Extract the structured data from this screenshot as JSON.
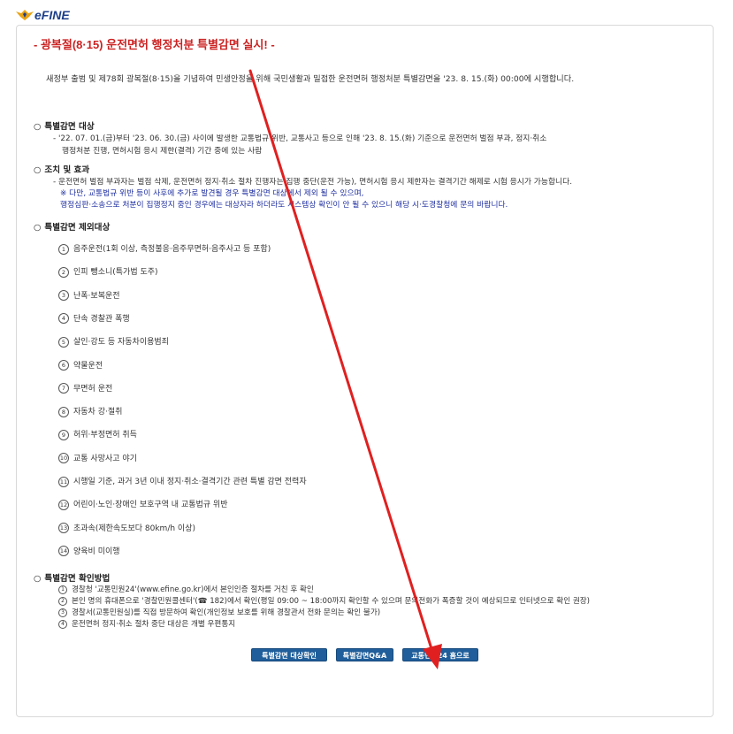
{
  "header": {
    "logo_text": "eFINE"
  },
  "notice": {
    "title": "- 광복절(8·15) 운전면허 행정처분 특별감면 실시! -",
    "intro": "새정부 출범 및 제78회 광복절(8·15)을 기념하여 민생안정을 위해 국민생활과 밀접한 운전면허 행정처분 특별감면을 '23. 8. 15.(화) 00:00에 시행합니다.",
    "sections": {
      "target": {
        "heading": "특별감면 대상",
        "lines": [
          "- '22. 07. 01.(금)부터 '23. 06. 30.(금) 사이에 발생한 교통법규 위반, 교통사고 등으로 인해 '23. 8. 15.(화) 기준으로 운전면허 벌점 부과, 정지·취소",
          "행정처분 진행, 면허시험 응시 제한(결격) 기간 중에 있는 사람"
        ]
      },
      "measures": {
        "heading": "조치 및 효과",
        "lines": [
          "- 운전면허 벌점 부과자는 벌점 삭제, 운전면허 정지·취소 절차 진행자는 집행 중단(운전 가능), 면허시험 응시 제한자는 결격기간 해제로 시험 응시가 가능합니다.",
          "※ 다만, 교통법규 위반 등이 사후에 추가로 발견될 경우 특별감면 대상에서 제외 될 수 있으며,",
          "행정심판·소송으로 처분이 집행정지 중인 경우에는 대상자라 하더라도 시스템상 확인이 안 될 수 있으니 해당 시·도경찰청에 문의 바랍니다."
        ]
      },
      "exclusions": {
        "heading": "특별감면 제외대상",
        "items": [
          {
            "num": "1",
            "text": "음주운전(1회 이상, 측정불응·음주무면허·음주사고 등 포함)"
          },
          {
            "num": "2",
            "text": "인피 뺑소니(특가법 도주)"
          },
          {
            "num": "3",
            "text": "난폭·보복운전"
          },
          {
            "num": "4",
            "text": "단속 경찰관 폭행"
          },
          {
            "num": "5",
            "text": "살인·강도 등 자동차이용범죄"
          },
          {
            "num": "6",
            "text": "약물운전"
          },
          {
            "num": "7",
            "text": "무면허 운전"
          },
          {
            "num": "8",
            "text": "자동차 강·절취"
          },
          {
            "num": "9",
            "text": "허위·부정면허 취득"
          },
          {
            "num": "10",
            "text": "교통 사망사고 야기"
          },
          {
            "num": "11",
            "text": "시행일 기준, 과거 3년 이내 정지·취소·결격기간 관련 특별 감면 전력자"
          },
          {
            "num": "12",
            "text": "어린이·노인·장애인 보호구역 내 교통법규 위반"
          },
          {
            "num": "13",
            "text": "초과속(제한속도보다 80km/h 이상)"
          },
          {
            "num": "14",
            "text": "양육비 미이행"
          }
        ]
      },
      "check": {
        "heading": "특별감면 확인방법",
        "items": [
          {
            "num": "1",
            "text": "경찰청 '교통민원24'(www.efine.go.kr)에서 본인인증 절차를 거친 후 확인"
          },
          {
            "num": "2",
            "text": "본인 명의 휴대폰으로 '경찰민원콜센터'(☎ 182)에서 확인(평일 09:00 ~ 18:00까지 확인할 수 있으며 문의전화가 폭증할 것이 예상되므로 인터넷으로 확인 권장)"
          },
          {
            "num": "3",
            "text": "경찰서(교통민원실)를 직접 방문하여 확인(개인정보 보호를 위해 경찰관서 전화 문의는 확인 불가)"
          },
          {
            "num": "4",
            "text": "운전면허 정지·취소 절차 중단 대상은 개별 우편통지"
          }
        ]
      }
    }
  },
  "buttons": {
    "check_target": "특별감면 대상확인",
    "qna": "특별감면Q&A",
    "go_home": "교통민원24 홈으로"
  },
  "colors": {
    "title_red": "#cc2222",
    "note_blue": "#2030a0",
    "button_blue": "#1f5e9a",
    "annotation_arrow": "#e02020"
  }
}
